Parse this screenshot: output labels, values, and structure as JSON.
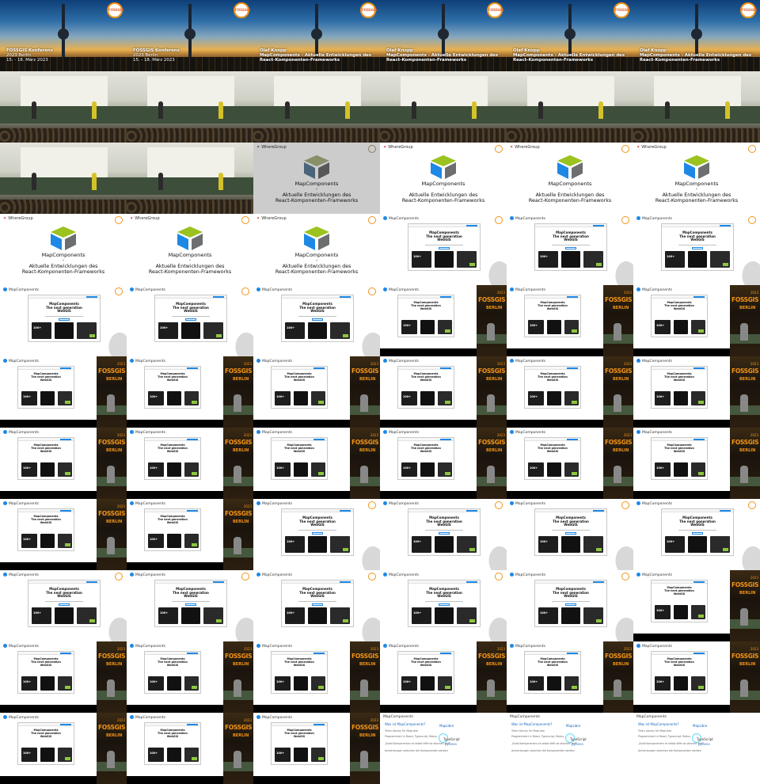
{
  "title_slide": {
    "event": "FOSSGIS Konferenz",
    "year_city": "2023 Berlin",
    "dates": "15. - 18. März 2023",
    "speaker": "Olaf Knopp",
    "talk": "MapComponents - Aktuelle Entwicklungen des React-Komponenten-Frameworks"
  },
  "logo_slide": {
    "org": "WhereGroup",
    "product": "MapComponents",
    "dash": "-",
    "subtitle_line1": "Aktuelle Entwicklungen des",
    "subtitle_line2": "React-Komponenten-Frameworks"
  },
  "web_slide": {
    "brand": "MapComponents",
    "headline_line1": "MapComponents",
    "headline_line2": "The next generation",
    "headline_line3": "WebGIS"
  },
  "video_overlay": {
    "fossgis": "FOSSGIS",
    "berlin": "BERLIN",
    "year": "2023"
  },
  "was_slide": {
    "heading": "Was ist MapComponents?",
    "line1": "Tüten Library für MapLibre",
    "line2": "Programmiert in React, Typescript, Redux",
    "line3": "„Build Komponenten et selbst diffe strukturiert mit",
    "line4": "Anmerkungen zwischen die Komponenten werden",
    "maplibre": "MapLibre",
    "typescript": "TypeScript",
    "pyproj": "pyRevo"
  },
  "badge": "FOSSGIS",
  "colors": {
    "fossgis_orange": "#f39317",
    "mapcomponents_blue": "#1e88e5",
    "cube_green": "#9bc21f",
    "cube_gray": "#6d6e70",
    "cube_blue": "#1e88e5"
  },
  "grid": {
    "columns": 6,
    "rows": 11
  },
  "frames": [
    "title",
    "title",
    "title-speaker-a",
    "title-speaker-b",
    "title-speaker-b",
    "title-speaker-b",
    "hall",
    "hall",
    "hall",
    "hall",
    "hall",
    "hall",
    "hall",
    "hall",
    "logo-gray",
    "logo",
    "logo",
    "logo",
    "logo",
    "logo",
    "logo",
    "web",
    "web",
    "web",
    "web",
    "web",
    "web",
    "webv",
    "webv",
    "webv",
    "webv",
    "webv",
    "webv",
    "webv",
    "webv",
    "webv",
    "webv",
    "webv",
    "webv",
    "webv",
    "webv",
    "webv",
    "webv",
    "webv",
    "web",
    "web",
    "web",
    "web",
    "web",
    "web",
    "web",
    "web",
    "web",
    "webv",
    "webv",
    "webv",
    "webv",
    "webv",
    "webv",
    "webv",
    "webv",
    "webv",
    "webv",
    "was",
    "was",
    "was"
  ]
}
